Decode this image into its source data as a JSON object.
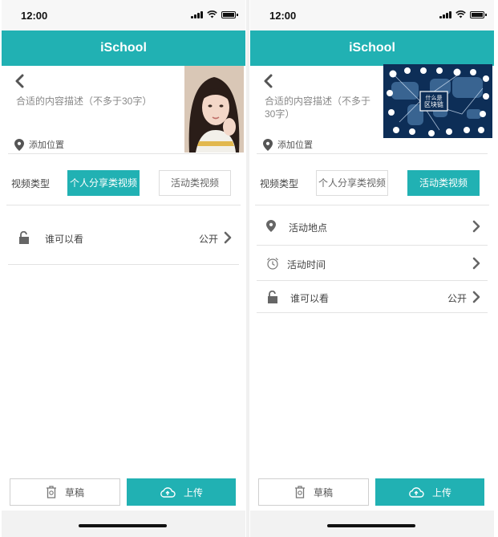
{
  "status": {
    "time": "12:00"
  },
  "app_title": "iSchool",
  "compose": {
    "description_placeholder": "合适的内容描述（不多于30字）",
    "description_line1": "合适的内容描述（不多于",
    "description_line2": "30字）",
    "add_location": "添加位置"
  },
  "video_type": {
    "label": "视频类型",
    "options": [
      "个人分享类视频",
      "活动类视频"
    ]
  },
  "left_screen": {
    "selected_type": "个人分享类视频",
    "rows": [
      {
        "label": "谁可以看",
        "value": "公开",
        "icon": "lock-icon"
      }
    ]
  },
  "right_screen": {
    "selected_type": "活动类视频",
    "rows": [
      {
        "label": "活动地点",
        "value": "",
        "icon": "location-pin-icon"
      },
      {
        "label": "活动时间",
        "value": "",
        "icon": "alarm-clock-icon"
      },
      {
        "label": "谁可以看",
        "value": "公开",
        "icon": "lock-icon"
      }
    ],
    "thumbnail_caption_line1": "什么是",
    "thumbnail_caption_line2": "区块链"
  },
  "actions": {
    "draft": "草稿",
    "upload": "上传"
  },
  "colors": {
    "accent": "#21b1b3",
    "divider": "#e3e3e3",
    "text": "#444444"
  }
}
